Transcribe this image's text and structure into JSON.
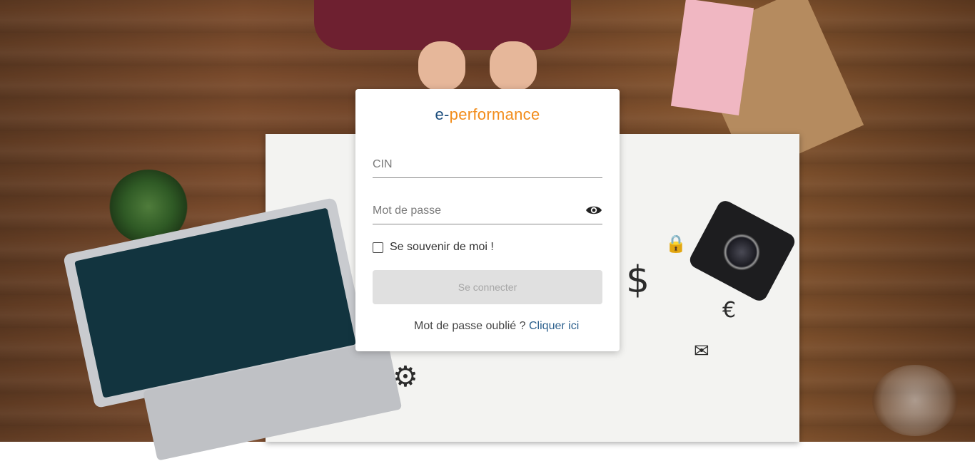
{
  "brand": {
    "logo_prefix": "e-",
    "logo_suffix": "performance",
    "prefix_color": "#1a4c7c",
    "suffix_color": "#f28c1a"
  },
  "login_form": {
    "cin": {
      "placeholder": "CIN",
      "value": ""
    },
    "password": {
      "placeholder": "Mot de passe",
      "value": "",
      "toggle_icon": "eye-icon"
    },
    "remember_me": {
      "label": "Se souvenir de moi !",
      "checked": false
    },
    "submit": {
      "label": "Se connecter",
      "enabled": false
    },
    "forgot": {
      "text": "Mot de passe oublié ?",
      "link_text": "Cliquer ici"
    }
  },
  "colors": {
    "button_disabled_bg": "#e0e0e0",
    "button_disabled_text": "#a6a6a6",
    "link": "#2b5f8c"
  }
}
